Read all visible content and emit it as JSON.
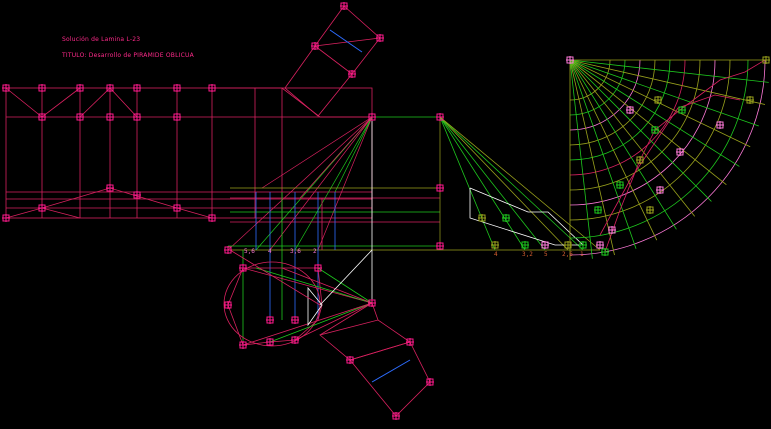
{
  "header": {
    "line1": "Solución de Lamina L-23",
    "line2": "TITULO: Desarrollo de PIRAMIDE OBLICUA"
  },
  "colors": {
    "background": "#000000",
    "magenta": "#ff1a8c",
    "crimson": "#d8215f",
    "green": "#1ec81e",
    "olive": "#9aa21c",
    "white": "#ffffff",
    "blue": "#2d6cff",
    "pink": "#ff7ad9",
    "marker": "#ff1a8c"
  },
  "labels": {
    "bottom_proj": [
      "5,6",
      "4",
      "3,6",
      "2"
    ],
    "true_length": [
      "4",
      "3,2",
      "5",
      "2,6",
      "1"
    ]
  }
}
